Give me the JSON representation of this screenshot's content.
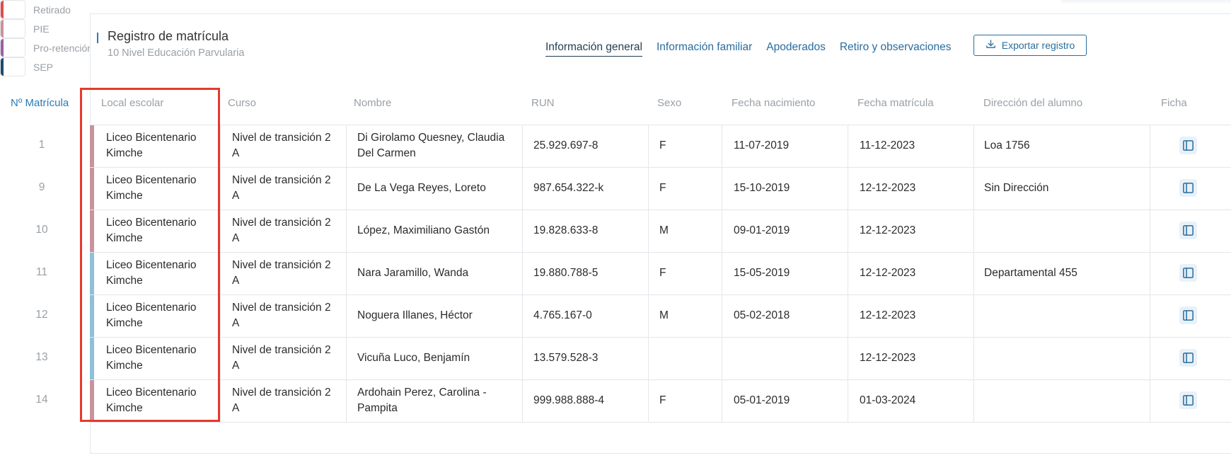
{
  "header": {
    "title": "Registro de matrícula",
    "subtitle": "10 Nivel Educación Parvularia"
  },
  "tabs": [
    {
      "label": "Información general",
      "active": true
    },
    {
      "label": "Información familiar",
      "active": false
    },
    {
      "label": "Apoderados",
      "active": false
    },
    {
      "label": "Retiro y observaciones",
      "active": false
    }
  ],
  "export_label": "Exportar registro",
  "columns": {
    "num": "Nº Matrícula",
    "local": "Local escolar",
    "curso": "Curso",
    "nombre": "Nombre",
    "run": "RUN",
    "sexo": "Sexo",
    "nacimiento": "Fecha nacimiento",
    "matricula": "Fecha matrícula",
    "direccion": "Dirección del alumno",
    "ficha": "Ficha"
  },
  "rows": [
    {
      "num": "1",
      "local_1": "Liceo Bicentenario",
      "local_2": "Kimche",
      "curso_1": "Nivel de transición 2",
      "curso_2": "A",
      "nombre_1": "Di Girolamo Quesney, Claudia",
      "nombre_2": "Del Carmen",
      "run": "25.929.697-8",
      "sexo": "F",
      "nacimiento": "11-07-2019",
      "matricula": "11-12-2023",
      "direccion": "Loa 1756",
      "tag": "pie"
    },
    {
      "num": "9",
      "local_1": "Liceo Bicentenario",
      "local_2": "Kimche",
      "curso_1": "Nivel de transición 2",
      "curso_2": "A",
      "nombre_1": "De La Vega Reyes, Loreto",
      "nombre_2": "",
      "run": "987.654.322-k",
      "sexo": "F",
      "nacimiento": "15-10-2019",
      "matricula": "12-12-2023",
      "direccion": "Sin Dirección",
      "tag": "pie"
    },
    {
      "num": "10",
      "local_1": "Liceo Bicentenario",
      "local_2": "Kimche",
      "curso_1": "Nivel de transición 2",
      "curso_2": "A",
      "nombre_1": "López, Maximiliano Gastón",
      "nombre_2": "",
      "run": "19.828.633-8",
      "sexo": "M",
      "nacimiento": "09-01-2019",
      "matricula": "12-12-2023",
      "direccion": "",
      "tag": "pie"
    },
    {
      "num": "11",
      "local_1": "Liceo Bicentenario",
      "local_2": "Kimche",
      "curso_1": "Nivel de transición 2",
      "curso_2": "A",
      "nombre_1": "Nara Jaramillo, Wanda",
      "nombre_2": "",
      "run": "19.880.788-5",
      "sexo": "F",
      "nacimiento": "15-05-2019",
      "matricula": "12-12-2023",
      "direccion": "Departamental 455",
      "tag": "blue"
    },
    {
      "num": "12",
      "local_1": "Liceo Bicentenario",
      "local_2": "Kimche",
      "curso_1": "Nivel de transición 2",
      "curso_2": "A",
      "nombre_1": "Noguera Illanes, Héctor",
      "nombre_2": "",
      "run": "4.765.167-0",
      "sexo": "M",
      "nacimiento": "05-02-2018",
      "matricula": "12-12-2023",
      "direccion": "",
      "tag": "blue"
    },
    {
      "num": "13",
      "local_1": "Liceo Bicentenario",
      "local_2": "Kimche",
      "curso_1": "Nivel de transición 2",
      "curso_2": "A",
      "nombre_1": "Vicuña Luco, Benjamín",
      "nombre_2": "",
      "run": "13.579.528-3",
      "sexo": "",
      "nacimiento": "",
      "matricula": "12-12-2023",
      "direccion": "",
      "tag": "blue"
    },
    {
      "num": "14",
      "local_1": "Liceo Bicentenario",
      "local_2": "Kimche",
      "curso_1": "Nivel de transición 2",
      "curso_2": "A",
      "nombre_1": "Ardohain Perez, Carolina -",
      "nombre_2": "Pampita",
      "run": "999.988.888-4",
      "sexo": "F",
      "nacimiento": "05-01-2019",
      "matricula": "01-03-2024",
      "direccion": "",
      "tag": "pie"
    }
  ],
  "legend": [
    {
      "label": "Retirado",
      "color": "#e34a4a"
    },
    {
      "label": "PIE",
      "color": "#c9939b"
    },
    {
      "label": "Pro-retención",
      "color": "#9b5fa6"
    },
    {
      "label": "SEP",
      "color": "#1e4a6b"
    }
  ],
  "tag_colors": {
    "pie": "#c9939b",
    "blue": "#8fbfd9"
  },
  "icons": {
    "export": "download-icon",
    "ficha": "sidebar-panel-icon"
  }
}
